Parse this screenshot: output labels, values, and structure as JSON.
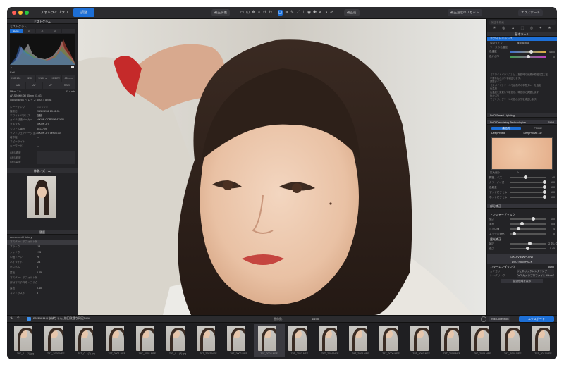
{
  "titlebar": {
    "title": "DxO PhotoLab — 20221211るなほちゃん_前田敦遠ち岡辺RAW — Z9T_2000.NEF (1)",
    "tab_library": "フォトライブラリ",
    "tab_customize": "調整",
    "compare_button": "補正前後",
    "compare_original": "補正前",
    "reset_button": "補正設定のリセット",
    "export_button": "エクスポート"
  },
  "left_panel": {
    "histogram_title": "ヒストグラム",
    "histogram_label": "ヒストグラム",
    "histogram_tabs": [
      "RGB",
      "R",
      "G",
      "B",
      "L"
    ],
    "exif_label": "Exif",
    "exif_values": [
      "ISO 100",
      "f/2.0",
      "1/100 s",
      "+0.3 EV",
      "85 mm"
    ],
    "exif_buttons": [
      "WB",
      "AF",
      "MF",
      "RAW"
    ],
    "camera": "Nikon Z 9",
    "lens": "AF-S NIKKOR 85mm f/1.4G",
    "dimensions": "5504 x 8256 (クロップ: 5504 x 8256)",
    "focal": "51.4 mb",
    "meta": [
      {
        "k": "レーティング",
        "v": "☆☆☆☆☆"
      },
      {
        "k": "撮影日",
        "v": "2022/12/11 13:51:31"
      },
      {
        "k": "ホワイトバランス",
        "v": "自動"
      },
      {
        "k": "カメラ製造メーカー",
        "v": "NIKON CORPORATION"
      },
      {
        "k": "カメラ名",
        "v": "NIKON Z 9"
      },
      {
        "k": "シリアル番号",
        "v": "3017709"
      },
      {
        "k": "ソフトウェアバージョン",
        "v": "NIKON Z 9 Ver.03.00"
      },
      {
        "k": "著作権",
        "v": "---"
      },
      {
        "k": "コピーライト",
        "v": "---"
      },
      {
        "k": "キーワード",
        "v": "---"
      }
    ],
    "gps": [
      {
        "k": "GPS 緯度",
        "v": ""
      },
      {
        "k": "GPS 経度",
        "v": ""
      },
      {
        "k": "GPS 高度",
        "v": ""
      }
    ],
    "navigator_title": "移動／ズーム",
    "history_title": "履歴",
    "history_label": "Advanced History",
    "history_items": [
      {
        "k": "マスター：デフォルト補正",
        "v": ""
      },
      {
        "k": "ブラック",
        "v": "-13"
      },
      {
        "k": "シャドウ",
        "v": "+15"
      },
      {
        "k": "中間トーン",
        "v": "+6"
      },
      {
        "k": "ハイライト",
        "v": "-24"
      },
      {
        "k": "白レベル",
        "v": "0"
      },
      {
        "k": "露出",
        "v": "0.45"
      },
      {
        "k": "マスター：デフォルト補正",
        "v": ""
      },
      {
        "k": "部分マスク作成・フラグ",
        "v": ""
      },
      {
        "k": "露出",
        "v": "0.40"
      },
      {
        "k": "コントラスト",
        "v": "3"
      }
    ]
  },
  "right_panel": {
    "search_placeholder": "補正を検索",
    "base_tools_title": "基本ツール",
    "wb_title": "ホワイトバランス",
    "wb_mode_label": "調整タイプ",
    "wb_mode_value": "撮影時設定",
    "wb_source_label": "ソースの色温度",
    "wb_temp_label": "色温度",
    "wb_temp_value": "4800",
    "wb_tint_label": "色かぶり",
    "wb_tint_value": "0",
    "smart_info_title": "DxO Smart Lighting",
    "smart_info_lines": [
      "［ホワイトバランス］は、撮影時の光源が原因で生じる",
      "不要な色かぶりを補正します。",
      "調整タイプ",
      "［スポイト］ツールで画像内の中間グレーを指定",
      "色温度",
      "色温度を変更して暖色系、寒色系に調整します。",
      "色かぶり",
      "マゼンタ、グリーンの色かぶりを補正します。"
    ],
    "smart_lighting": "DxO Smart Lighting",
    "denoise_title": "DxO Denoising Technologies",
    "denoise_badge": "RAW",
    "denoise_tabs": [
      "高品質",
      "PRIME"
    ],
    "denoise_options": [
      "DeepPRIME",
      "DeepPRIME XD"
    ],
    "denoise_zoom_label": "拡大縮小",
    "noise_sliders": [
      {
        "label": "輝度ノイズ",
        "value": "40"
      },
      {
        "label": "カラーノイズ",
        "value": "100"
      },
      {
        "label": "色収差",
        "value": "100"
      },
      {
        "label": "デッドピクセル",
        "value": "100"
      },
      {
        "label": "ホットピクセル",
        "value": "100"
      }
    ],
    "detail_title": "部分補正",
    "sharpen_title": "アンシャープマスク",
    "sharpen_sliders": [
      {
        "label": "強さ",
        "value": "100"
      },
      {
        "label": "半径",
        "value": "0.5"
      },
      {
        "label": "しきい値",
        "value": "4"
      },
      {
        "label": "エッジ平滑化",
        "value": "0"
      }
    ],
    "crop_title": "露光補正",
    "crop_sliders": [
      {
        "label": "補正",
        "value": "スタンダード"
      },
      {
        "label": "強さ",
        "value": "0.45"
      }
    ],
    "viewpoint": "DXO VIEWPOINT",
    "filmpack": "DXO FILMPACK",
    "color_title": "カラーレンダリング",
    "color_badge": "Auto",
    "color_category_label": "カテゴリー",
    "color_category_value": "ジェネリックレンダリング",
    "color_rendering_label": "レンダリング",
    "color_rendering_value": "DxO カメラプロファイル Nikon Z 9",
    "more_button": "拡張色域を表示"
  },
  "bottom_bar": {
    "folder_path": "20221211るなほちゃん_前田敦遠ち岡辺RAW",
    "image_count_label": "画像数：",
    "image_count": "1/195",
    "nik_button": "Nik Collection",
    "export_button": "エクスポート"
  },
  "filmstrip": [
    "Z9T_0 ...(1).jpg",
    "Z9T_2000.NEF",
    "Z9T_0 ...(2).jpg",
    "Z9T_2001.NEF",
    "Z9T_2001.NEF",
    "Z9T_0 ...(3).jpg",
    "Z9T_2002.NEF",
    "Z9T_2002.NEF",
    "Z9T_2003.NEF",
    "Z9T_2003.NEF",
    "Z9T_2004.NEF",
    "Z9T_2005.NEF",
    "Z9T_2006.NEF",
    "Z9T_2007.NEF",
    "Z9T_2008.NEF",
    "Z9T_2009.NEF",
    "Z9T_2010.NEF",
    "Z9T_2011.NEF"
  ],
  "colors": {
    "accent": "#1d6fd6",
    "panel": "#232326",
    "header": "#2f2f33"
  }
}
